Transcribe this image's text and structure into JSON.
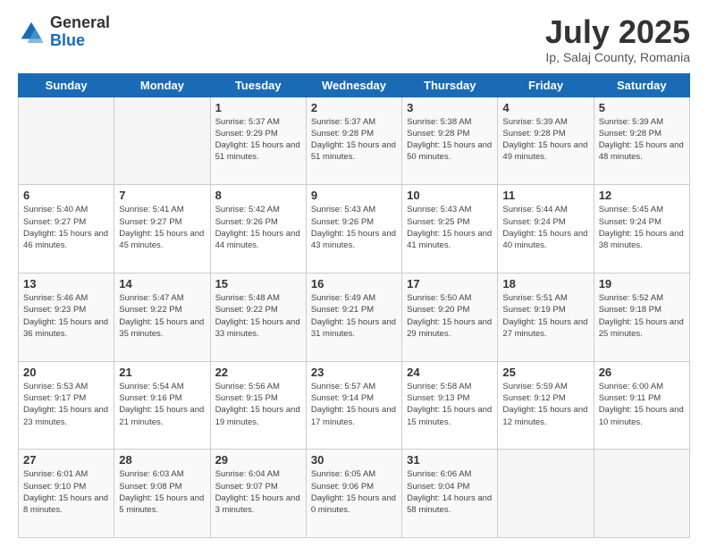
{
  "logo": {
    "general": "General",
    "blue": "Blue"
  },
  "header": {
    "title": "July 2025",
    "subtitle": "Ip, Salaj County, Romania"
  },
  "weekdays": [
    "Sunday",
    "Monday",
    "Tuesday",
    "Wednesday",
    "Thursday",
    "Friday",
    "Saturday"
  ],
  "weeks": [
    [
      {
        "day": "",
        "sunrise": "",
        "sunset": "",
        "daylight": ""
      },
      {
        "day": "",
        "sunrise": "",
        "sunset": "",
        "daylight": ""
      },
      {
        "day": "1",
        "sunrise": "Sunrise: 5:37 AM",
        "sunset": "Sunset: 9:29 PM",
        "daylight": "Daylight: 15 hours and 51 minutes."
      },
      {
        "day": "2",
        "sunrise": "Sunrise: 5:37 AM",
        "sunset": "Sunset: 9:28 PM",
        "daylight": "Daylight: 15 hours and 51 minutes."
      },
      {
        "day": "3",
        "sunrise": "Sunrise: 5:38 AM",
        "sunset": "Sunset: 9:28 PM",
        "daylight": "Daylight: 15 hours and 50 minutes."
      },
      {
        "day": "4",
        "sunrise": "Sunrise: 5:39 AM",
        "sunset": "Sunset: 9:28 PM",
        "daylight": "Daylight: 15 hours and 49 minutes."
      },
      {
        "day": "5",
        "sunrise": "Sunrise: 5:39 AM",
        "sunset": "Sunset: 9:28 PM",
        "daylight": "Daylight: 15 hours and 48 minutes."
      }
    ],
    [
      {
        "day": "6",
        "sunrise": "Sunrise: 5:40 AM",
        "sunset": "Sunset: 9:27 PM",
        "daylight": "Daylight: 15 hours and 46 minutes."
      },
      {
        "day": "7",
        "sunrise": "Sunrise: 5:41 AM",
        "sunset": "Sunset: 9:27 PM",
        "daylight": "Daylight: 15 hours and 45 minutes."
      },
      {
        "day": "8",
        "sunrise": "Sunrise: 5:42 AM",
        "sunset": "Sunset: 9:26 PM",
        "daylight": "Daylight: 15 hours and 44 minutes."
      },
      {
        "day": "9",
        "sunrise": "Sunrise: 5:43 AM",
        "sunset": "Sunset: 9:26 PM",
        "daylight": "Daylight: 15 hours and 43 minutes."
      },
      {
        "day": "10",
        "sunrise": "Sunrise: 5:43 AM",
        "sunset": "Sunset: 9:25 PM",
        "daylight": "Daylight: 15 hours and 41 minutes."
      },
      {
        "day": "11",
        "sunrise": "Sunrise: 5:44 AM",
        "sunset": "Sunset: 9:24 PM",
        "daylight": "Daylight: 15 hours and 40 minutes."
      },
      {
        "day": "12",
        "sunrise": "Sunrise: 5:45 AM",
        "sunset": "Sunset: 9:24 PM",
        "daylight": "Daylight: 15 hours and 38 minutes."
      }
    ],
    [
      {
        "day": "13",
        "sunrise": "Sunrise: 5:46 AM",
        "sunset": "Sunset: 9:23 PM",
        "daylight": "Daylight: 15 hours and 36 minutes."
      },
      {
        "day": "14",
        "sunrise": "Sunrise: 5:47 AM",
        "sunset": "Sunset: 9:22 PM",
        "daylight": "Daylight: 15 hours and 35 minutes."
      },
      {
        "day": "15",
        "sunrise": "Sunrise: 5:48 AM",
        "sunset": "Sunset: 9:22 PM",
        "daylight": "Daylight: 15 hours and 33 minutes."
      },
      {
        "day": "16",
        "sunrise": "Sunrise: 5:49 AM",
        "sunset": "Sunset: 9:21 PM",
        "daylight": "Daylight: 15 hours and 31 minutes."
      },
      {
        "day": "17",
        "sunrise": "Sunrise: 5:50 AM",
        "sunset": "Sunset: 9:20 PM",
        "daylight": "Daylight: 15 hours and 29 minutes."
      },
      {
        "day": "18",
        "sunrise": "Sunrise: 5:51 AM",
        "sunset": "Sunset: 9:19 PM",
        "daylight": "Daylight: 15 hours and 27 minutes."
      },
      {
        "day": "19",
        "sunrise": "Sunrise: 5:52 AM",
        "sunset": "Sunset: 9:18 PM",
        "daylight": "Daylight: 15 hours and 25 minutes."
      }
    ],
    [
      {
        "day": "20",
        "sunrise": "Sunrise: 5:53 AM",
        "sunset": "Sunset: 9:17 PM",
        "daylight": "Daylight: 15 hours and 23 minutes."
      },
      {
        "day": "21",
        "sunrise": "Sunrise: 5:54 AM",
        "sunset": "Sunset: 9:16 PM",
        "daylight": "Daylight: 15 hours and 21 minutes."
      },
      {
        "day": "22",
        "sunrise": "Sunrise: 5:56 AM",
        "sunset": "Sunset: 9:15 PM",
        "daylight": "Daylight: 15 hours and 19 minutes."
      },
      {
        "day": "23",
        "sunrise": "Sunrise: 5:57 AM",
        "sunset": "Sunset: 9:14 PM",
        "daylight": "Daylight: 15 hours and 17 minutes."
      },
      {
        "day": "24",
        "sunrise": "Sunrise: 5:58 AM",
        "sunset": "Sunset: 9:13 PM",
        "daylight": "Daylight: 15 hours and 15 minutes."
      },
      {
        "day": "25",
        "sunrise": "Sunrise: 5:59 AM",
        "sunset": "Sunset: 9:12 PM",
        "daylight": "Daylight: 15 hours and 12 minutes."
      },
      {
        "day": "26",
        "sunrise": "Sunrise: 6:00 AM",
        "sunset": "Sunset: 9:11 PM",
        "daylight": "Daylight: 15 hours and 10 minutes."
      }
    ],
    [
      {
        "day": "27",
        "sunrise": "Sunrise: 6:01 AM",
        "sunset": "Sunset: 9:10 PM",
        "daylight": "Daylight: 15 hours and 8 minutes."
      },
      {
        "day": "28",
        "sunrise": "Sunrise: 6:03 AM",
        "sunset": "Sunset: 9:08 PM",
        "daylight": "Daylight: 15 hours and 5 minutes."
      },
      {
        "day": "29",
        "sunrise": "Sunrise: 6:04 AM",
        "sunset": "Sunset: 9:07 PM",
        "daylight": "Daylight: 15 hours and 3 minutes."
      },
      {
        "day": "30",
        "sunrise": "Sunrise: 6:05 AM",
        "sunset": "Sunset: 9:06 PM",
        "daylight": "Daylight: 15 hours and 0 minutes."
      },
      {
        "day": "31",
        "sunrise": "Sunrise: 6:06 AM",
        "sunset": "Sunset: 9:04 PM",
        "daylight": "Daylight: 14 hours and 58 minutes."
      },
      {
        "day": "",
        "sunrise": "",
        "sunset": "",
        "daylight": ""
      },
      {
        "day": "",
        "sunrise": "",
        "sunset": "",
        "daylight": ""
      }
    ]
  ]
}
